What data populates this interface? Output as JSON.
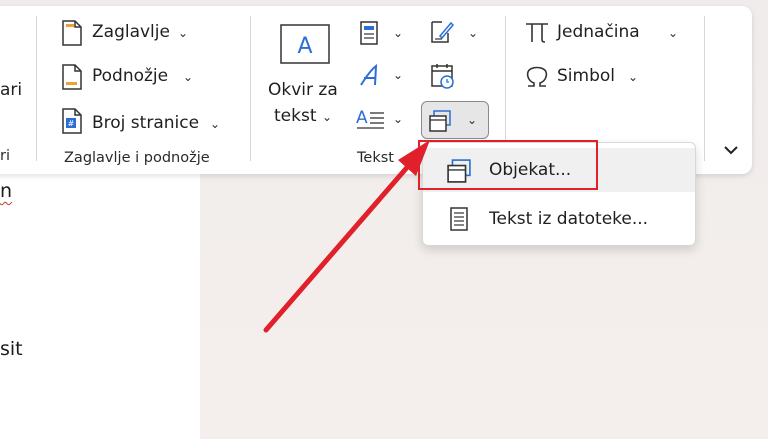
{
  "ribbon": {
    "left_cut": {
      "top_label": "ari",
      "bottom_label": "ri"
    },
    "header_footer": {
      "header_label": "Zaglavlje",
      "footer_label": "Podnožje",
      "page_number_label": "Broj stranice",
      "group_title": "Zaglavlje i podnožje"
    },
    "text_group": {
      "textbox_label_line1": "Okvir za",
      "textbox_label_line2": "tekst",
      "group_title": "Tekst"
    },
    "symbols": {
      "equation_label": "Jednačina",
      "symbol_label": "Simbol"
    }
  },
  "dropdown": {
    "items": [
      {
        "label": "Objekat...",
        "icon": "object-icon"
      },
      {
        "label": "Tekst iz datoteke...",
        "icon": "text-file-icon"
      }
    ]
  },
  "document": {
    "line1": "n",
    "line2": "sit"
  },
  "colors": {
    "highlight_box": "#e0202a",
    "arrow": "#e0202a"
  }
}
